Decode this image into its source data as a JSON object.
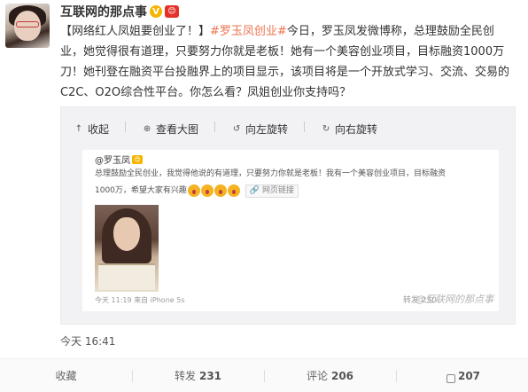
{
  "post": {
    "username": "互联网的那点事",
    "verified_badge": "V",
    "level_badge": "😊",
    "text_prefix": "【网络红人凤姐要创业了！】",
    "topic": "#罗玉凤创业#",
    "text_main": "今日，罗玉凤发微博称，总理鼓励全民创业，她觉得很有道理，只要努力你就是老板！她有一个美容创业项目，目标融资1000万刀！她刊登在融资平台投融界上的项目显示，该项目将是一个开放式学习、交流、交易的C2C、O2O综合性平台。你怎么看？凤姐创业你支持吗？",
    "time": "今天 16:41"
  },
  "embed_toolbar": {
    "collapse": "收起",
    "view_large": "查看大图",
    "rotate_left": "向左旋转",
    "rotate_right": "向右旋转"
  },
  "retweet": {
    "user": "@罗玉凤",
    "text_line1": "总理鼓励全民创业，我觉得他说的有道理，只要努力你就是老板！我有一个美容创业项目，目标融资",
    "text_line2": "1000万，希望大家有兴趣",
    "weblink": "网页链接",
    "meta": "今天 11:19 来自 iPhone 5s",
    "count": "转发 250",
    "watermark": "@互联网的那点事"
  },
  "actions": {
    "favorite": "收藏",
    "repost_label": "转发",
    "repost_count": "231",
    "comment_label": "评论",
    "comment_count": "206",
    "like_count": "207"
  },
  "colors": {
    "topic": "#eb7350",
    "verified": "#f7b500"
  }
}
